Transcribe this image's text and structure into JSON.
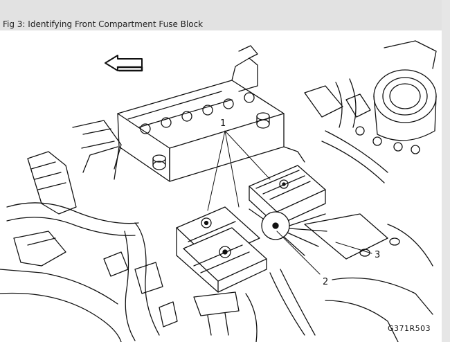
{
  "caption": "Fig 3: Identifying Front Compartment Fuse Block",
  "callouts": [
    {
      "label": "1"
    },
    {
      "label": "2"
    },
    {
      "label": "3"
    }
  ],
  "figure_code": "G371R503",
  "colors": {
    "caption_bar": "#e2e2e2",
    "line": "#111111"
  }
}
